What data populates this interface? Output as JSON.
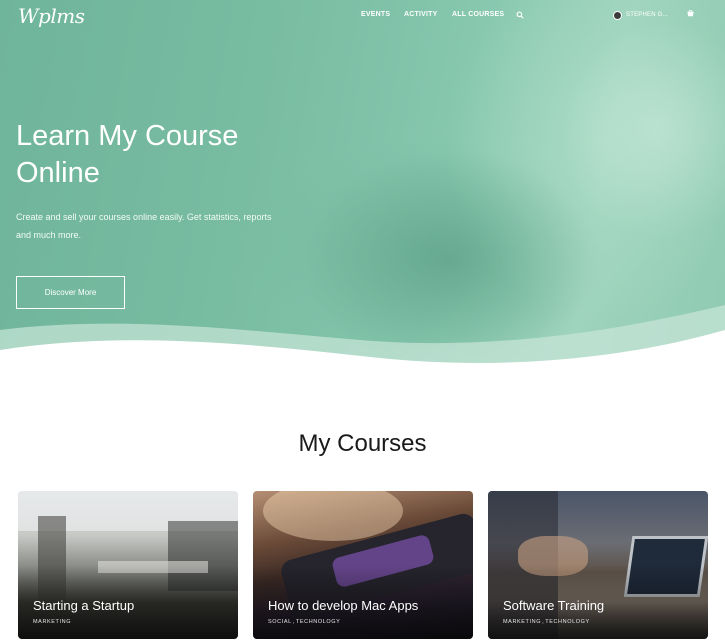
{
  "header": {
    "logo": "Wplms",
    "nav": [
      "EVENTS",
      "ACTIVITY",
      "ALL COURSES"
    ],
    "user_name": "STEPHEN G...",
    "search_icon": "search-icon",
    "cart_icon": "cart-icon"
  },
  "hero": {
    "title_line1": "Learn My Course",
    "title_line2": "Online",
    "subtitle": "Create and sell your courses online easily. Get statistics, reports and much more.",
    "button_label": "Discover More",
    "accent_color": "#78bca2"
  },
  "courses": {
    "title": "My Courses",
    "items": [
      {
        "title": "Starting a Startup",
        "categories": [
          "MARKETING"
        ]
      },
      {
        "title": "How to develop Mac Apps",
        "categories": [
          "SOCIAL",
          "TECHNOLOGY"
        ]
      },
      {
        "title": "Software Training",
        "categories": [
          "MARKETING",
          "TECHNOLOGY"
        ]
      }
    ]
  }
}
